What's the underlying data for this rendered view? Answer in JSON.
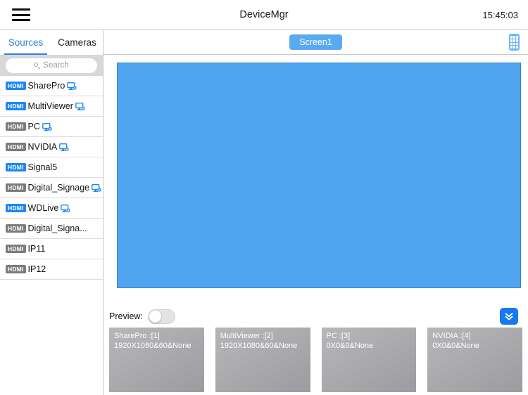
{
  "topbar": {
    "menu_icon": "hamburger-menu-icon",
    "title": "DeviceMgr",
    "time": "15:45:03"
  },
  "sidebar": {
    "tabs": [
      {
        "label": "Sources",
        "active": true
      },
      {
        "label": "Cameras",
        "active": false
      }
    ],
    "search": {
      "placeholder": "Search",
      "value": "",
      "icon": "search-icon"
    },
    "sources": [
      {
        "badge": "HDMI",
        "badge_color": "#1e88f0",
        "label": "SharePro",
        "has_monitor_icon": true
      },
      {
        "badge": "HDMI",
        "badge_color": "#1e88f0",
        "label": "MultiViewer",
        "has_monitor_icon": true
      },
      {
        "badge": "HDMI",
        "badge_color": "#7c7c7c",
        "label": "PC",
        "has_monitor_icon": true
      },
      {
        "badge": "HDMI",
        "badge_color": "#7c7c7c",
        "label": "NVIDIA",
        "has_monitor_icon": true
      },
      {
        "badge": "HDMI",
        "badge_color": "#1e88f0",
        "label": "Signal5",
        "has_monitor_icon": false
      },
      {
        "badge": "HDMI",
        "badge_color": "#7c7c7c",
        "label": "Digital_Signage",
        "has_monitor_icon": true
      },
      {
        "badge": "HDMI",
        "badge_color": "#1e88f0",
        "label": "WDLive",
        "has_monitor_icon": true
      },
      {
        "badge": "HDMI",
        "badge_color": "#7c7c7c",
        "label": "Digital_Signa...",
        "has_monitor_icon": false
      },
      {
        "badge": "HDMI",
        "badge_color": "#7c7c7c",
        "label": "IP11",
        "has_monitor_icon": false
      },
      {
        "badge": "HDMI",
        "badge_color": "#7c7c7c",
        "label": "IP12",
        "has_monitor_icon": false
      }
    ]
  },
  "main": {
    "screen_tab": "Screen1",
    "remote_icon": "remote-control-icon",
    "canvas_color": "#4fa5ef",
    "preview": {
      "label": "Preview:",
      "enabled": false
    },
    "collapse_icon": "chevron-double-down-icon",
    "thumbnails": [
      {
        "title": "SharePro :[1]",
        "details": "1920X1080&60&None"
      },
      {
        "title": "MultiViewer :[2]",
        "details": "1920X1080&60&None"
      },
      {
        "title": "PC :[3]",
        "details": "0X0&0&None"
      },
      {
        "title": "NVIDIA :[4]",
        "details": "0X0&0&None"
      }
    ]
  },
  "colors": {
    "accent": "#1e88f0",
    "tab_active": "#2f7fe0",
    "chip": "#5aaaf2",
    "canvas": "#4fa5ef"
  }
}
